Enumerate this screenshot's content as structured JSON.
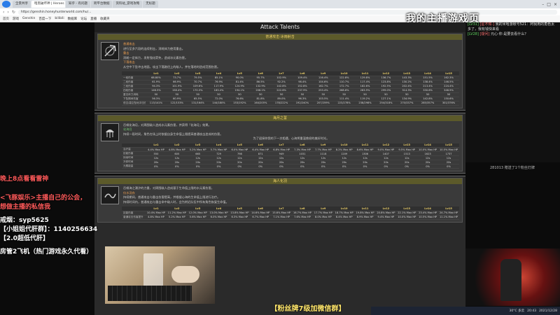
{
  "browser": {
    "tabs": [
      {
        "label": "全景共享",
        "active": false
      },
      {
        "label": "暗黑破坏神 | Heroes",
        "active": true
      },
      {
        "label": "知乎 - 有问题",
        "active": false
      },
      {
        "label": "跨平台数据",
        "active": false
      },
      {
        "label": "资料站_游戏攻略",
        "active": false
      },
      {
        "label": "无标题",
        "active": false
      }
    ],
    "url": "https://genshin.honeyhunterworld.com/hu/...",
    "bookmarks": [
      "首页",
      "游戏",
      "Genshin",
      "百度一下",
      "bilibili",
      "数据库",
      "论坛",
      "直播",
      "收藏夹"
    ]
  },
  "stream_title": "我的主播游戏页",
  "page": {
    "title": "Attack Talents",
    "sections": [
      {
        "heading": "普通攻击·冰雨射击",
        "desc_lines": [
          "普通攻击",
          "进行至多六段的连续射击，消耗体力使用重击。",
          "重击",
          "消耗一定体力，发射强化箭矢，造成冰元素伤害。",
          "下落攻击",
          "从空中下坠冲击地面，攻击下落路径上的敌人，并在落地时造成范围伤害。"
        ],
        "columns": [
          "Lv1",
          "Lv2",
          "Lv3",
          "Lv4",
          "Lv5",
          "Lv6",
          "Lv7",
          "Lv8",
          "Lv9",
          "Lv10",
          "Lv11",
          "Lv12",
          "Lv13",
          "Lv14",
          "Lv15"
        ],
        "rows": [
          {
            "label": "一段伤害",
            "values": [
              "68.80%",
              "73.7%",
              "79.5%",
              "85.1%",
              "90.0%",
              "95.7%",
              "102.9%",
              "109.4%",
              "116.4%",
              "122.8%",
              "129.8%",
              "136.7%",
              "143.3%",
              "151.5%",
              "162.3%"
            ]
          },
          {
            "label": "二段伤害",
            "values": [
              "61.9%",
              "66.9%",
              "70.7%",
              "76.9%",
              "81.4%",
              "86.5%",
              "92.2%",
              "98.4%",
              "104.6%",
              "110.7%",
              "117.4%",
              "123.8%",
              "130.2%",
              "138.4%",
              "146.5%"
            ]
          },
          {
            "label": "三段伤害",
            "values": [
              "94.3%",
              "101.9%",
              "109.6%",
              "117.9%",
              "124.9%",
              "132.9%",
              "142.8%",
              "152.8%",
              "162.7%",
              "172.7%",
              "182.6%",
              "192.5%",
              "202.4%",
              "213.4%",
              "224.4%"
            ]
          },
          {
            "label": "四段伤害",
            "values": [
              "146.5%",
              "158.4%",
              "170.3%",
              "183.4%",
              "194.1%",
              "206.1%",
              "222.6%",
              "237.9%",
              "253.4%",
              "268.6%",
              "283.9%",
              "299.0%",
              "314.3%",
              "330.6%",
              "346.9%"
            ]
          },
          {
            "label": "重击体力消耗",
            "values": [
              "50",
              "50",
              "50",
              "50",
              "50",
              "50",
              "50",
              "50",
              "50",
              "50",
              "50",
              "50",
              "50",
              "50",
              "50"
            ]
          },
          {
            "label": "下坠期间伤害",
            "values": [
              "56.3%",
              "60.9%",
              "65.5%",
              "72.0%",
              "76.6%",
              "81.8%",
              "89.0%",
              "96.3%",
              "103.5%",
              "111.4%",
              "119.2%",
              "127.1%",
              "134.9%",
              "142.8%",
              "150.6%"
            ]
          },
          {
            "label": "低空/高空坠地冲击伤害",
            "values": [
              "113/141%",
              "122/153%",
              "131/164%",
              "144/180%",
              "153/192%",
              "164/205%",
              "178/222%",
              "192/240%",
              "207/259%",
              "223/278%",
              "238/298%",
              "254/318%",
              "270/337%",
              "285/357%",
              "301/376%"
            ]
          }
        ]
      },
      {
        "heading": "海月之誓",
        "desc_lines": [
          "召唤化海月，对周围敌人造成水元素伤害，并获得「化海月」效果。",
          "化海月",
          "持续一段时间，角色在场上时依据自身生命值上限提高普通攻击造成的伤害。",
          "为了迎接你我的下一次相遇，心海将重温曾经的美好时光。"
        ],
        "columns": [
          "Lv1",
          "Lv2",
          "Lv3",
          "Lv4",
          "Lv5",
          "Lv6",
          "Lv7",
          "Lv8",
          "Lv9",
          "Lv10",
          "Lv11",
          "Lv12",
          "Lv13",
          "Lv14",
          "Lv15"
        ],
        "rows": [
          {
            "label": "治疗量",
            "values": [
              "4.4% Max HP",
              "4.8% Max HP",
              "5.2% Max HP",
              "5.7% Max HP",
              "6.0% Max HP",
              "6.4% Max HP",
              "6.8% Max HP",
              "7.3% Max HP",
              "7.7% Max HP",
              "8.2% Max HP",
              "8.6% Max HP",
              "9.0% Max HP",
              "9.5% Max HP",
              "10.0% Max HP",
              "10.5% Max HP"
            ]
          },
          {
            "label": "技能伤害",
            "values": [
              "550",
              "605",
              "665",
              "729",
              "798",
              "871",
              "949",
              "1031",
              "1118",
              "1209",
              "1306",
              "1407",
              "1513",
              "1623",
              "1737"
            ]
          },
          {
            "label": "持续时间",
            "values": [
              "12s",
              "12s",
              "12s",
              "12s",
              "12s",
              "12s",
              "12s",
              "12s",
              "12s",
              "12s",
              "12s",
              "12s",
              "12s",
              "12s",
              "12s"
            ]
          },
          {
            "label": "冷却时间",
            "values": [
              "20s",
              "20s",
              "20s",
              "20s",
              "20s",
              "20s",
              "20s",
              "20s",
              "20s",
              "20s",
              "20s",
              "20s",
              "20s",
              "20s",
              "20s"
            ]
          },
          {
            "label": "元素能量",
            "values": [
              "0%",
              "0%",
              "0%",
              "0%",
              "0%",
              "0%",
              "0%",
              "0%",
              "0%",
              "0%",
              "0%",
              "0%",
              "0%",
              "0%",
              "0%"
            ]
          }
        ]
      },
      {
        "heading": "海人化羽",
        "desc_lines": [
          "召唤海之潮汐的力量，对周围敌人造成基于生命值上限的水元素伤害。",
          "仪水羽衣",
          "持续期间，普通攻击与重击伤害提高，并根据心海的生命值上限进行治疗。",
          "持续时间内，普通攻击与重击命中敌人时，会为附近队伍中所有角色恢复生命值。"
        ],
        "columns": [
          "Lv1",
          "Lv2",
          "Lv3",
          "Lv4",
          "Lv5",
          "Lv6",
          "Lv7",
          "Lv8",
          "Lv9",
          "Lv10",
          "Lv11",
          "Lv12",
          "Lv13",
          "Lv14",
          "Lv15"
        ],
        "rows": [
          {
            "label": "技能伤害",
            "values": [
              "10.4% Max HP",
              "11.2% Max HP",
              "12.0% Max HP",
              "13.0% Max HP",
              "13.8% Max HP",
              "14.6% Max HP",
              "15.6% Max HP",
              "16.7% Max HP",
              "17.7% Max HP",
              "18.7% Max HP",
              "19.8% Max HP",
              "20.8% Max HP",
              "22.1% Max HP",
              "23.4% Max HP",
              "24.7% Max HP"
            ]
          },
          {
            "label": "普通攻击伤害提升",
            "values": [
              "4.8% Max HP",
              "5.2% Max HP",
              "5.6% Max HP",
              "6.0% Max HP",
              "6.3% Max HP",
              "6.7% Max HP",
              "7.1% Max HP",
              "7.6% Max HP",
              "8.0% Max HP",
              "8.4% Max HP",
              "8.9% Max HP",
              "9.4% Max HP",
              "10.0% Max HP",
              "10.5% Max HP",
              "11.1% Max HP"
            ]
          }
        ]
      }
    ]
  },
  "left_overlay": [
    {
      "text": "晚上8点看看雷神",
      "color": "red"
    },
    {
      "text": "<飞豚娱乐>主播自己的公会，",
      "color": "red"
    },
    {
      "text": "想做主播的私信我",
      "color": "red"
    },
    {
      "text": "戒烟：syp5625",
      "color": "white"
    },
    {
      "text": "【小姐姐代肝群】：1140256634",
      "color": "white"
    },
    {
      "text": "【2.0超低代肝】",
      "color": "white"
    },
    {
      "text": "房管2飞机（热门游戏永久代看）",
      "color": "white"
    }
  ],
  "chat": [
    {
      "level": "[LV31]",
      "name": "[星不知·]",
      "text": "我的米哈游账号521：阿我用的角色太多了，我有钱快来看"
    },
    {
      "level": "[LV28]",
      "name": "[疑问]",
      "text": "元心·你·是要去看什么？"
    }
  ],
  "gift_text": "2810​1​3 赠送了1个粉丝灯牌",
  "banner": "【粉丝牌7级加微信群】",
  "taskbar": {
    "weather": "30°C 多云",
    "time": "20:43",
    "date": "2021/12/28"
  }
}
